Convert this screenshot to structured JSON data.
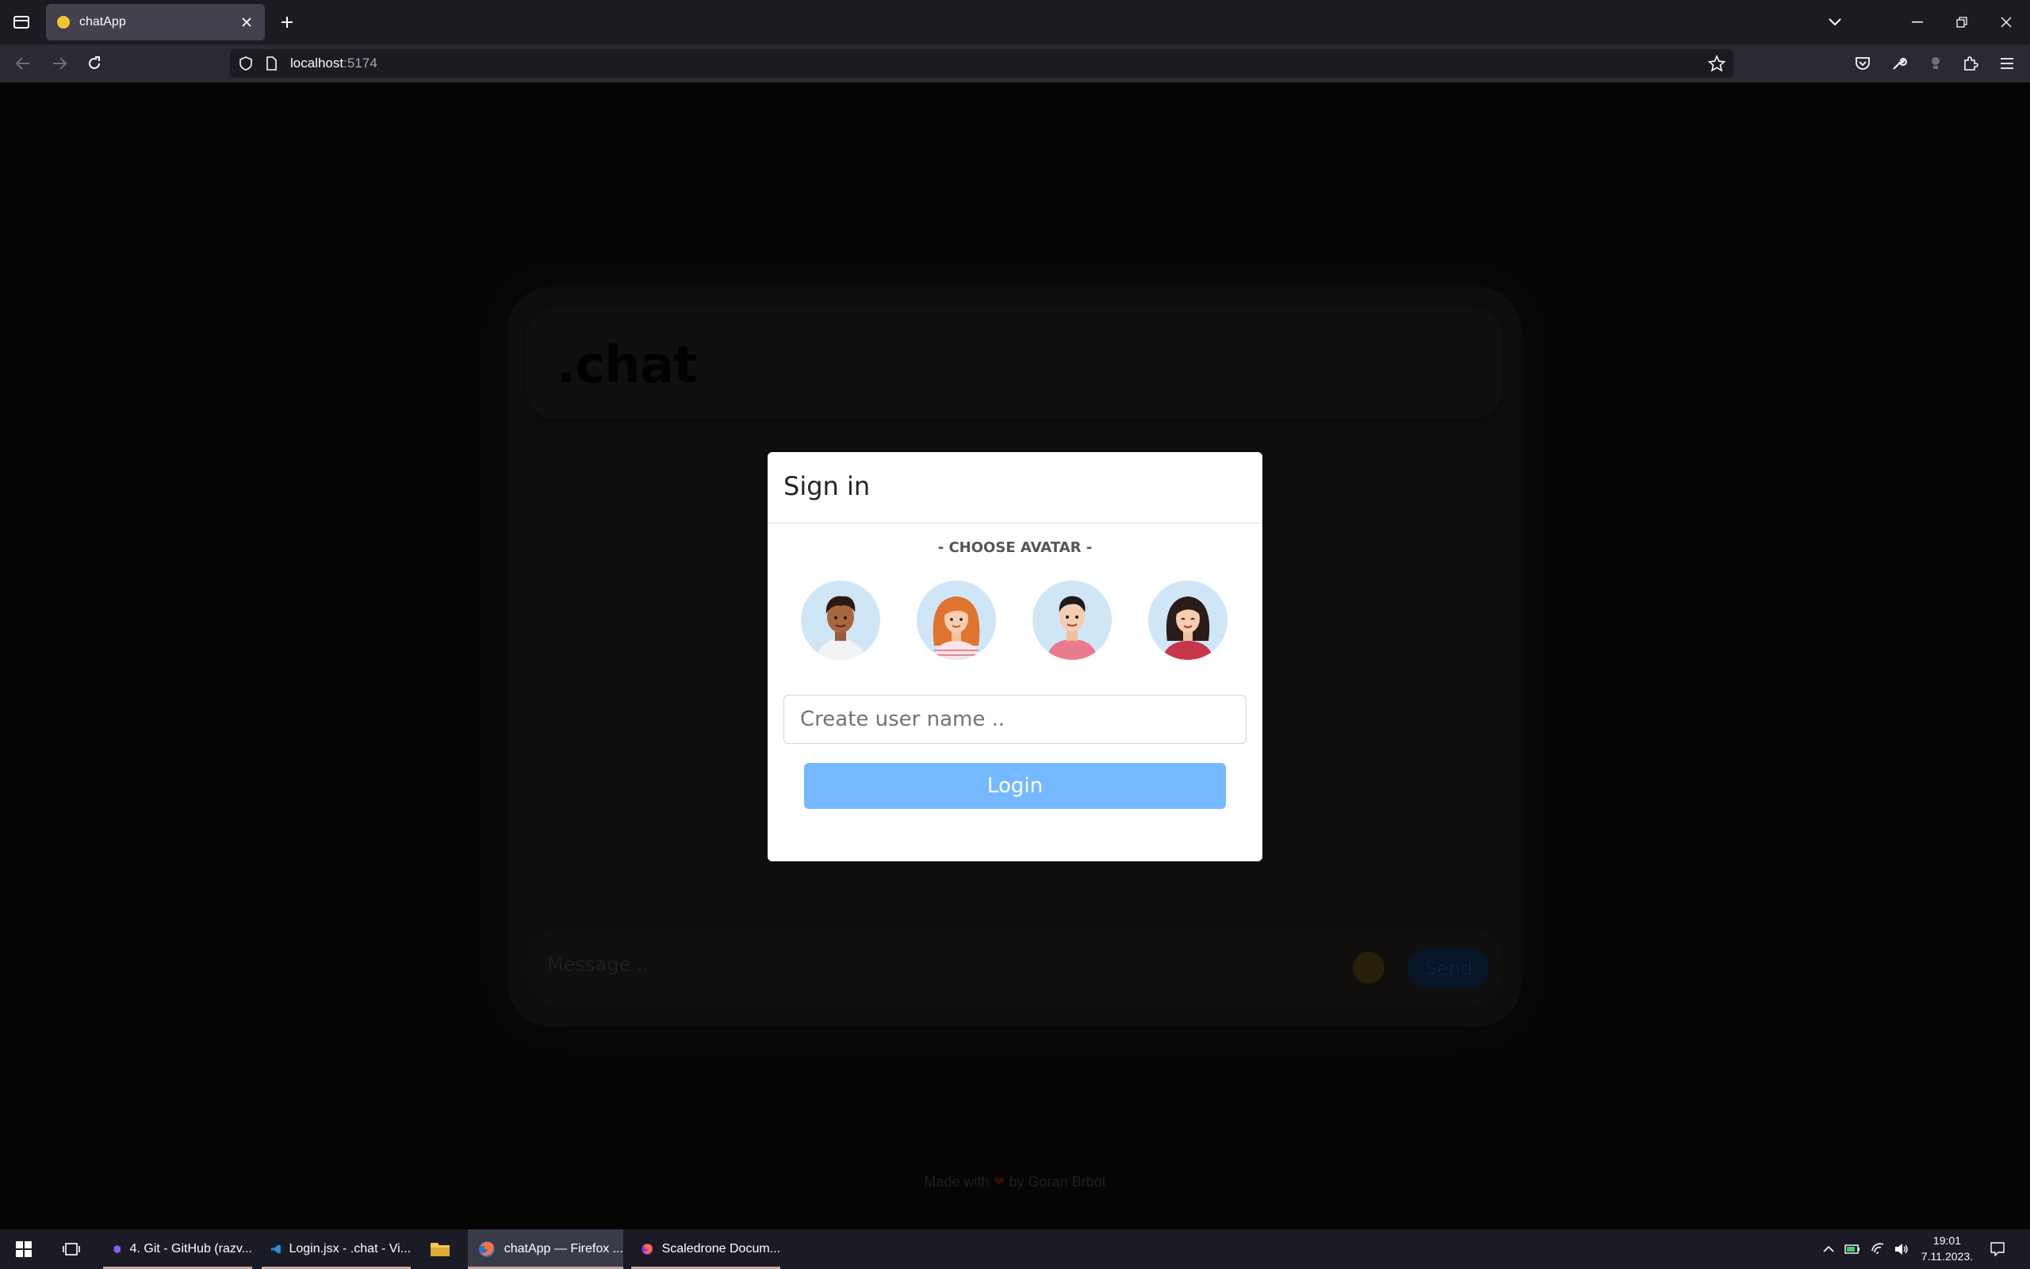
{
  "browser": {
    "tab_title": "chatApp",
    "url_host": "localhost",
    "url_port": ":5174"
  },
  "app": {
    "logo": ".chat",
    "message_placeholder": "Message ..",
    "send_label": "Send",
    "footer_prefix": "Made with",
    "footer_heart": "❤",
    "footer_suffix": "by Goran Brbot"
  },
  "modal": {
    "title": "Sign in",
    "choose_avatar_label": "- CHOOSE AVATAR -",
    "avatars": [
      "avatar-man-curly-hair",
      "avatar-woman-orange-hair",
      "avatar-man-short-hair",
      "avatar-woman-dark-hair"
    ],
    "username_placeholder": "Create user name ..",
    "login_label": "Login"
  },
  "taskbar": {
    "apps": [
      {
        "label": "4. Git - GitHub (razv..."
      },
      {
        "label": "Login.jsx - .chat - Vi..."
      },
      {
        "label": ""
      },
      {
        "label": "chatApp — Firefox ..."
      },
      {
        "label": "Scaledrone Docum..."
      }
    ],
    "time": "19:01",
    "date": "7.11.2023."
  },
  "colors": {
    "accent": "#74b9ff",
    "page_bg": "#0b0a0a"
  }
}
